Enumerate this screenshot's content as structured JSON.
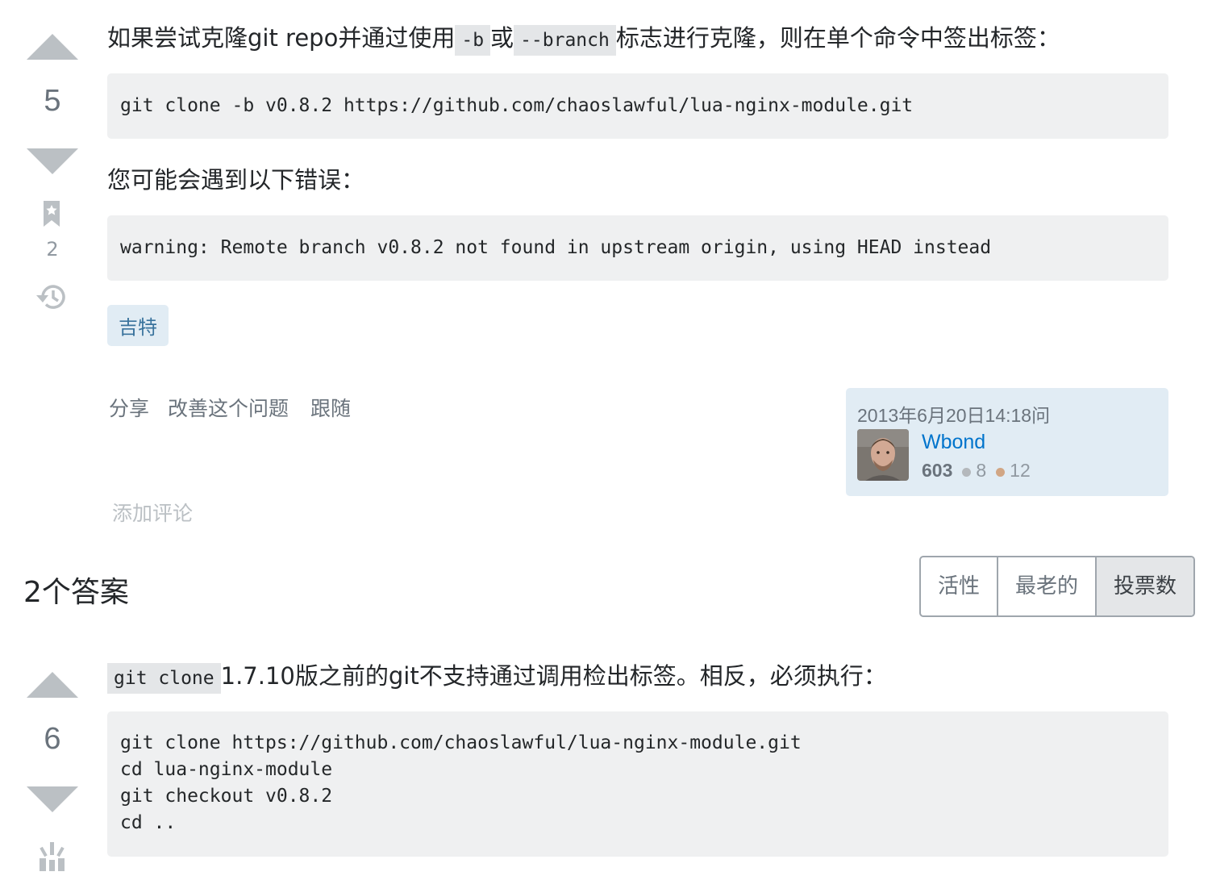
{
  "question": {
    "score": "5",
    "bookmark_count": "2",
    "intro_text_1": "如果尝试克隆git repo并通过使用",
    "intro_code_1": "-b",
    "intro_text_2": "或",
    "intro_code_2": "--branch",
    "intro_text_3": "标志进行克隆，则在单个命令中签出标签：",
    "code_block_1": "git clone -b v0.8.2 https://github.com/chaoslawful/lua-nginx-module.git",
    "error_intro": "您可能会遇到以下错误：",
    "code_block_2": "warning: Remote branch v0.8.2 not found in upstream origin, using HEAD instead",
    "tag": "吉特",
    "menu": {
      "share": "分享",
      "improve": "改善这个问题",
      "follow": "跟随"
    },
    "add_comment": "添加评论",
    "owner": {
      "asked": "2013年6月20日14:18问",
      "name": "Wbond",
      "reputation": "603",
      "silver_badges": "8",
      "bronze_badges": "12"
    }
  },
  "answers": {
    "header": "2个答案",
    "sort_options": [
      "活性",
      "最老的",
      "投票数"
    ],
    "active_sort": "投票数"
  },
  "answer": {
    "score": "6",
    "intro_code": "git clone",
    "intro_text": "1.7.10版之前的git不支持通过调用检出标签。相反，必须执行：",
    "code_block": "git clone https://github.com/chaoslawful/lua-nginx-module.git\ncd lua-nginx-module\ngit checkout v0.8.2\ncd .."
  },
  "colors": {
    "accent_link": "#0074cc",
    "tag_bg": "#e1ecf4",
    "code_bg": "#eff0f1",
    "silver": "#b4b8bc",
    "bronze": "#d1a684"
  }
}
